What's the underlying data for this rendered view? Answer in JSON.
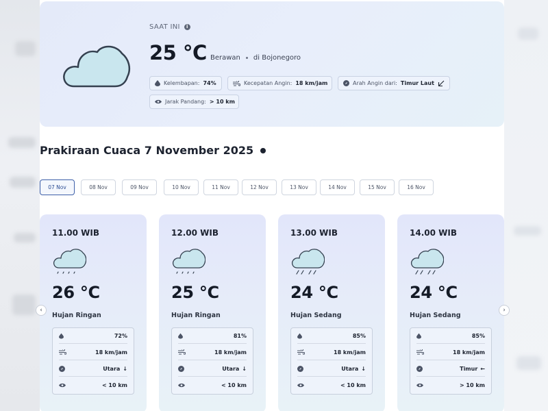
{
  "current": {
    "label": "SAAT INI",
    "temp": "25 °C",
    "condition": "Berawan",
    "location": "di Bojonegoro",
    "humidity_label": "Kelembapan:",
    "humidity_value": "74%",
    "wind_speed_label": "Kecepatan Angin:",
    "wind_speed_value": "18 km/jam",
    "wind_dir_label": "Arah Angin dari:",
    "wind_dir_value": "Timur Laut",
    "visibility_label": "Jarak Pandang:",
    "visibility_value": "> 10 km"
  },
  "forecast": {
    "title": "Prakiraan Cuaca 7 November 2025"
  },
  "date_tabs": [
    {
      "label": "07 Nov",
      "active": true
    },
    {
      "label": "08 Nov"
    },
    {
      "label": "09 Nov"
    },
    {
      "label": "10 Nov"
    },
    {
      "label": "11 Nov"
    },
    {
      "label": "12 Nov"
    },
    {
      "label": "13 Nov"
    },
    {
      "label": "14 Nov"
    },
    {
      "label": "15 Nov"
    },
    {
      "label": "16 Nov"
    }
  ],
  "hourly": [
    {
      "time": "11.00 WIB",
      "temp": "26 °C",
      "desc": "Hujan Ringan",
      "humidity": "72%",
      "wind_speed": "18 km/jam",
      "wind_dir": "Utara",
      "wind_arrow": "↓",
      "visibility": "< 10 km",
      "icon": "light-rain-icon"
    },
    {
      "time": "12.00 WIB",
      "temp": "25 °C",
      "desc": "Hujan Ringan",
      "humidity": "81%",
      "wind_speed": "18 km/jam",
      "wind_dir": "Utara",
      "wind_arrow": "↓",
      "visibility": "< 10 km",
      "icon": "light-rain-icon"
    },
    {
      "time": "13.00 WIB",
      "temp": "24 °C",
      "desc": "Hujan Sedang",
      "humidity": "85%",
      "wind_speed": "18 km/jam",
      "wind_dir": "Utara",
      "wind_arrow": "↓",
      "visibility": "< 10 km",
      "icon": "moderate-rain-icon"
    },
    {
      "time": "14.00 WIB",
      "temp": "24 °C",
      "desc": "Hujan Sedang",
      "humidity": "85%",
      "wind_speed": "18 km/jam",
      "wind_dir": "Timur",
      "wind_arrow": "←",
      "visibility": "> 10 km",
      "icon": "moderate-rain-icon"
    }
  ],
  "nav": {
    "prev": "‹",
    "next": "›"
  },
  "colors": {
    "accent": "#3d5fa8",
    "cloud_fill": "#c9e6ee",
    "cloud_stroke": "#34404f"
  }
}
